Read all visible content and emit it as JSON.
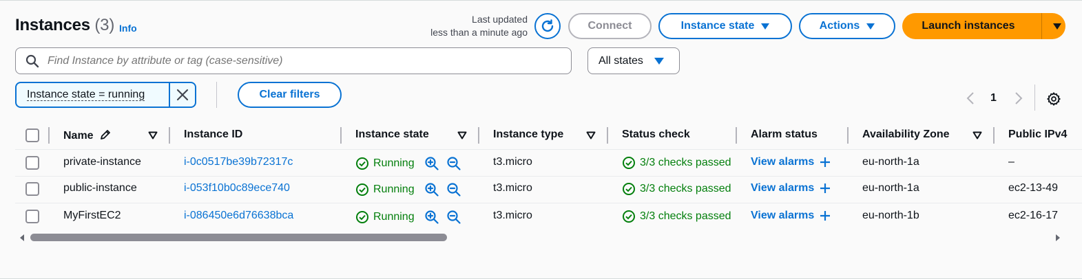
{
  "header": {
    "title": "Instances",
    "count": "(3)",
    "info": "Info",
    "last_updated_line1": "Last updated",
    "last_updated_line2": "less than a minute ago"
  },
  "toolbar": {
    "connect": "Connect",
    "instance_state": "Instance state",
    "actions": "Actions",
    "launch": "Launch instances"
  },
  "search": {
    "placeholder": "Find Instance by attribute or tag (case-sensitive)"
  },
  "states_select": {
    "value": "All states"
  },
  "filter": {
    "token": "Instance state = running",
    "clear": "Clear filters"
  },
  "pagination": {
    "page": "1"
  },
  "columns": {
    "name": "Name",
    "instance_id": "Instance ID",
    "instance_state": "Instance state",
    "instance_type": "Instance type",
    "status_check": "Status check",
    "alarm_status": "Alarm status",
    "availability_zone": "Availability Zone",
    "public_ipv4": "Public IPv4"
  },
  "rows": [
    {
      "name": "private-instance",
      "instance_id": "i-0c0517be39b72317c",
      "state": "Running",
      "type": "t3.micro",
      "status": "3/3 checks passed",
      "alarm": "View alarms",
      "zone": "eu-north-1a",
      "public": "–"
    },
    {
      "name": "public-instance",
      "instance_id": "i-053f10b0c89ece740",
      "state": "Running",
      "type": "t3.micro",
      "status": "3/3 checks passed",
      "alarm": "View alarms",
      "zone": "eu-north-1a",
      "public": "ec2-13-49"
    },
    {
      "name": "MyFirstEC2",
      "instance_id": "i-086450e6d76638bca",
      "state": "Running",
      "type": "t3.micro",
      "status": "3/3 checks passed",
      "alarm": "View alarms",
      "zone": "eu-north-1b",
      "public": "ec2-16-17"
    }
  ],
  "colors": {
    "link": "#0972d3",
    "success": "#037f0c",
    "primary": "#ff9900"
  },
  "icons": {
    "refresh": "refresh-icon",
    "search": "search-icon",
    "close": "close-icon",
    "settings": "gear-icon",
    "edit": "pencil-icon",
    "sort": "sort-triangle-icon",
    "zoom_in": "zoom-in-icon",
    "zoom_out": "zoom-out-icon",
    "running": "check-circle-icon",
    "add": "plus-icon"
  }
}
